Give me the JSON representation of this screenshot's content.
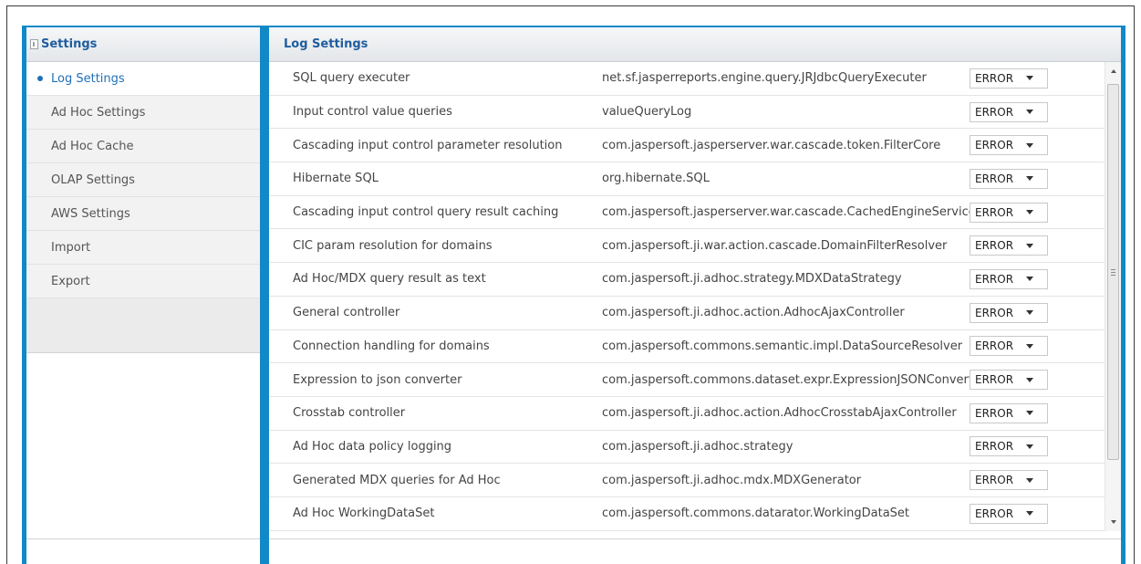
{
  "sidebar": {
    "title": "Settings",
    "items": [
      {
        "label": "Log Settings"
      },
      {
        "label": "Ad Hoc Settings"
      },
      {
        "label": "Ad Hoc Cache"
      },
      {
        "label": "OLAP Settings"
      },
      {
        "label": "AWS Settings"
      },
      {
        "label": "Import"
      },
      {
        "label": "Export"
      }
    ]
  },
  "main": {
    "title": "Log Settings",
    "rows": [
      {
        "name": "SQL query executer",
        "class": "net.sf.jasperreports.engine.query.JRJdbcQueryExecuter",
        "level": "ERROR"
      },
      {
        "name": "Input control value queries",
        "class": "valueQueryLog",
        "level": "ERROR"
      },
      {
        "name": "Cascading input control parameter resolution",
        "class": "com.jaspersoft.jasperserver.war.cascade.token.FilterCore",
        "level": "ERROR"
      },
      {
        "name": "Hibernate SQL",
        "class": "org.hibernate.SQL",
        "level": "ERROR"
      },
      {
        "name": "Cascading input control query result caching",
        "class": "com.jaspersoft.jasperserver.war.cascade.CachedEngineService",
        "level": "ERROR"
      },
      {
        "name": "CIC param resolution for domains",
        "class": "com.jaspersoft.ji.war.action.cascade.DomainFilterResolver",
        "level": "ERROR"
      },
      {
        "name": "Ad Hoc/MDX query result as text",
        "class": "com.jaspersoft.ji.adhoc.strategy.MDXDataStrategy",
        "level": "ERROR"
      },
      {
        "name": "General controller",
        "class": "com.jaspersoft.ji.adhoc.action.AdhocAjaxController",
        "level": "ERROR"
      },
      {
        "name": "Connection handling for domains",
        "class": "com.jaspersoft.commons.semantic.impl.DataSourceResolver",
        "level": "ERROR"
      },
      {
        "name": "Expression to json converter",
        "class": "com.jaspersoft.commons.dataset.expr.ExpressionJSONConverter",
        "level": "ERROR"
      },
      {
        "name": "Crosstab controller",
        "class": "com.jaspersoft.ji.adhoc.action.AdhocCrosstabAjaxController",
        "level": "ERROR"
      },
      {
        "name": "Ad Hoc data policy logging",
        "class": "com.jaspersoft.ji.adhoc.strategy",
        "level": "ERROR"
      },
      {
        "name": "Generated MDX queries for Ad Hoc",
        "class": "com.jaspersoft.ji.adhoc.mdx.MDXGenerator",
        "level": "ERROR"
      },
      {
        "name": "Ad Hoc WorkingDataSet",
        "class": "com.jaspersoft.commons.datarator.WorkingDataSet",
        "level": "ERROR"
      }
    ]
  },
  "colors": {
    "accent": "#1289c7",
    "link": "#1f6fb8",
    "header_text": "#1f5d9e"
  }
}
